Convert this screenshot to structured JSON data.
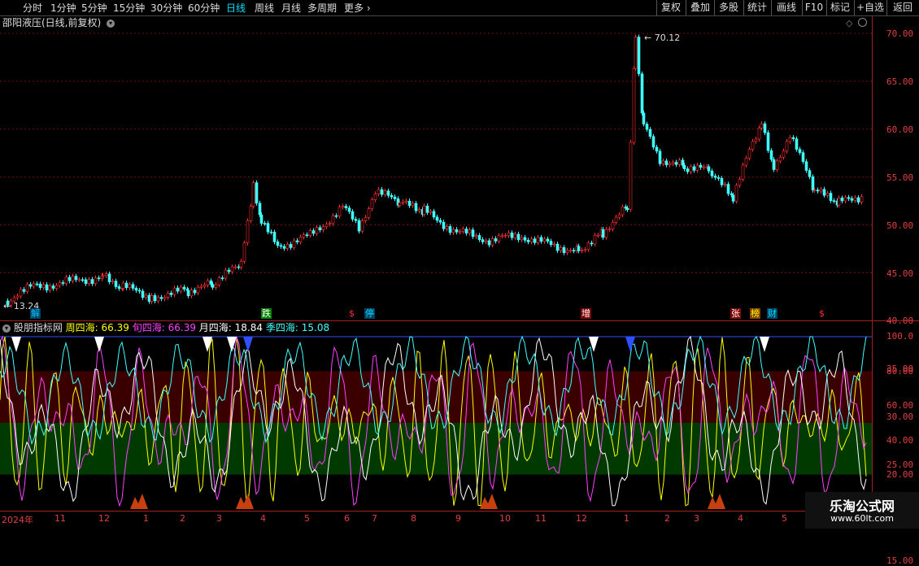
{
  "toolbar": {
    "periods": [
      "分时",
      "1分钟",
      "5分钟",
      "15分钟",
      "30分钟",
      "60分钟",
      "日线",
      "周线",
      "月线",
      "多周期",
      "更多"
    ],
    "active_period": "日线",
    "right_buttons": [
      "复权",
      "叠加",
      "多股",
      "统计",
      "画线",
      "F10",
      "标记",
      "+自选",
      "返回"
    ]
  },
  "stock": {
    "title": "邵阳液压(日线,前复权)"
  },
  "price_axis": {
    "labels": [
      "70.00",
      "65.00",
      "60.00",
      "55.00",
      "50.00",
      "45.00",
      "40.00",
      "35.00",
      "30.00",
      "25.00",
      "20.00",
      "15.00"
    ]
  },
  "annotations": {
    "high": "70.12",
    "low": "13.24"
  },
  "signals": [
    {
      "text": "解",
      "color": "#00c0ff",
      "bg": "#004060"
    },
    {
      "text": "跌",
      "color": "#ffffff",
      "bg": "#008000"
    },
    {
      "text": "$",
      "color": "#ff3030",
      "bg": "#000"
    },
    {
      "text": "停",
      "color": "#00e0ff",
      "bg": "#004060"
    },
    {
      "text": "增",
      "color": "#ffffff",
      "bg": "#800000"
    },
    {
      "text": "张",
      "color": "#ffffff",
      "bg": "#800000"
    },
    {
      "text": "榜",
      "color": "#ffff00",
      "bg": "#804000"
    },
    {
      "text": "财",
      "color": "#00e0ff",
      "bg": "#004060"
    },
    {
      "text": "$",
      "color": "#ff3030",
      "bg": "#000"
    }
  ],
  "indicator": {
    "name": "股朋指标网",
    "week_label": "周四海:",
    "week_value": "66.39",
    "xun_label": "旬四海:",
    "xun_value": "66.39",
    "month_label": "月四海:",
    "month_value": "18.84",
    "season_label": "季四海:",
    "season_value": "15.08",
    "axis": [
      "100.0",
      "80.00",
      "60.00",
      "40.00",
      "20.00"
    ],
    "colors": {
      "week": "#ffff00",
      "xun": "#ff40ff",
      "month": "#ffffff",
      "season": "#40ffff"
    }
  },
  "dates": [
    "2024年",
    "11",
    "12",
    "1",
    "2",
    "3",
    "4",
    "5",
    "6",
    "7",
    "8",
    "9",
    "10",
    "11",
    "12",
    "1",
    "2",
    "3",
    "4",
    "5"
  ],
  "watermark": {
    "title": "乐淘公式网",
    "url": "www.60lt.com"
  }
}
